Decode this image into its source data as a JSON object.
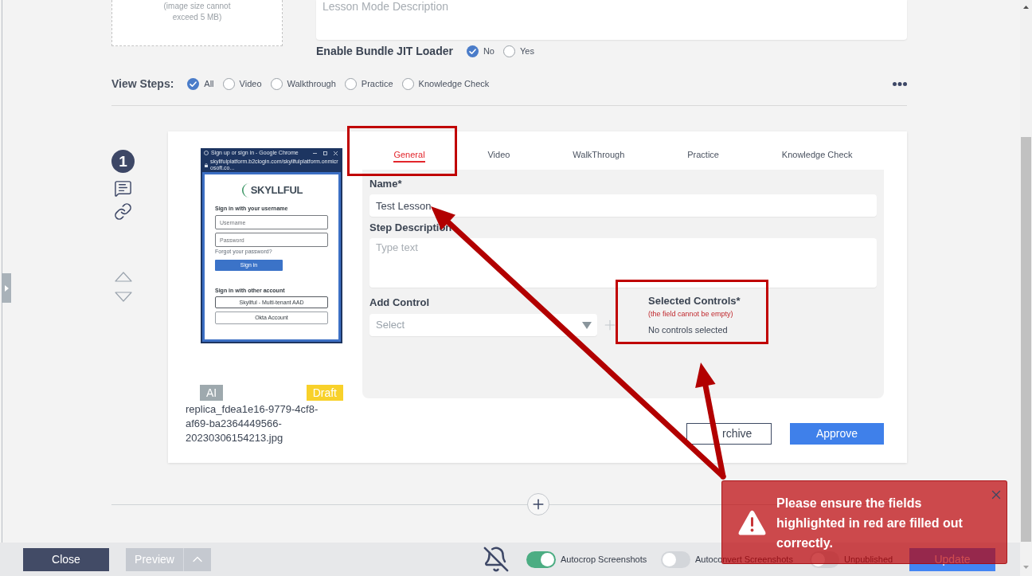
{
  "upload": {
    "hint": "(image size cannot exceed 5 MB)"
  },
  "description": {
    "placeholder": "Lesson Mode Description"
  },
  "jit_loader": {
    "label": "Enable Bundle JIT Loader",
    "options": [
      {
        "label": "No",
        "selected": true
      },
      {
        "label": "Yes",
        "selected": false
      }
    ]
  },
  "view_steps": {
    "label": "View Steps:",
    "options": [
      {
        "label": "All",
        "selected": true
      },
      {
        "label": "Video",
        "selected": false
      },
      {
        "label": "Walkthrough",
        "selected": false
      },
      {
        "label": "Practice",
        "selected": false
      },
      {
        "label": "Knowledge Check",
        "selected": false
      }
    ]
  },
  "step": {
    "number": "1",
    "thumbnail": {
      "window_title": "Sign up or sign in - Google Chrome",
      "url": "skyllfulplatform.b2clogin.com/skyllfulplatform.onmicrosoft.co...",
      "logo": "SKYLLFUL",
      "heading": "Sign in with your username",
      "fields": [
        {
          "placeholder": "Username"
        },
        {
          "placeholder": "Password"
        }
      ],
      "link": "Forgot your password?",
      "button": "Sign in",
      "other_heading": "Sign in with other account",
      "other_buttons": [
        "Skyllful - Multi-tenant AAD",
        "Okta Account"
      ]
    },
    "badges": [
      {
        "label": "AI",
        "color": "#9ea9ae"
      },
      {
        "label": "Draft",
        "color": "#f8d12a"
      }
    ],
    "filename": "replica_fdea1e16-9779-4cf8-af69-ba2364449566-20230306154213.jpg",
    "tabs": [
      {
        "label": "General",
        "selected": true
      },
      {
        "label": "Video",
        "selected": false
      },
      {
        "label": "WalkThrough",
        "selected": false
      },
      {
        "label": "Practice",
        "selected": false
      },
      {
        "label": "Knowledge Check",
        "selected": false
      }
    ],
    "form": {
      "name": {
        "label": "Name*",
        "value": "Test Lesson"
      },
      "description": {
        "label": "Step Description",
        "placeholder": "Type text"
      },
      "add_control": {
        "label": "Add Control",
        "placeholder": "Select"
      },
      "selected_controls": {
        "label": "Selected Controls*",
        "error": "(the field cannot be empty)",
        "empty_text": "No controls selected"
      }
    },
    "buttons": [
      {
        "label": "rchive",
        "kind": "outline"
      },
      {
        "label": "Approve",
        "kind": "primary"
      }
    ]
  },
  "bottom_bar": {
    "close": "Close",
    "preview": {
      "label": "Preview",
      "disabled": true
    },
    "toggles": [
      {
        "label": "Autocrop Screenshots",
        "on": true
      },
      {
        "label": "Autoconvert Screenshots",
        "on": false
      },
      {
        "label": "Unpublished",
        "on": false
      }
    ],
    "update": "Update"
  },
  "toast": {
    "message": "Please ensure the fields highlighted in red are filled out correctly."
  }
}
